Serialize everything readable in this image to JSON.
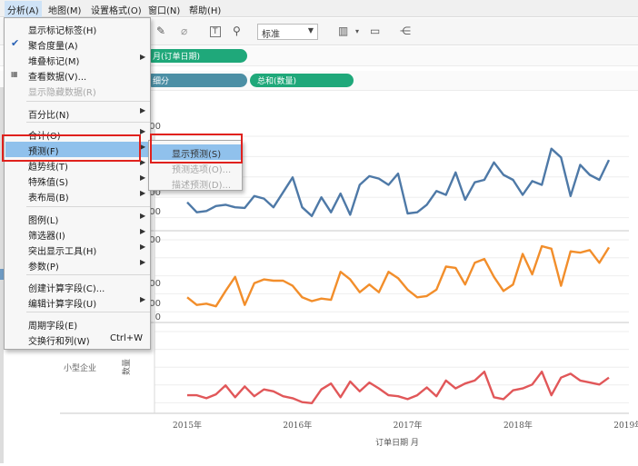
{
  "menubar": {
    "items": [
      "分析(A)",
      "地图(M)",
      "设置格式(O)",
      "窗口(N)",
      "帮助(H)"
    ]
  },
  "toolbar": {
    "mark_type": "标准"
  },
  "shelves": {
    "columns_pill": "月(订单日期)",
    "rows_pill_1": "细分",
    "rows_pill_2": "总和(数量)"
  },
  "analysis_menu": {
    "items": [
      {
        "label": "显示标记标签(H)"
      },
      {
        "label": "聚合度量(A)",
        "checked": true
      },
      {
        "label": "堆叠标记(M)",
        "submenu": true
      },
      {
        "label": "查看数据(V)..."
      },
      {
        "label": "显示隐藏数据(R)",
        "disabled": true
      },
      {
        "label": "百分比(N)",
        "submenu": true
      },
      {
        "label": "合计(O)",
        "submenu": true
      },
      {
        "label": "预测(F)",
        "submenu": true
      },
      {
        "label": "趋势线(T)",
        "submenu": true
      },
      {
        "label": "特殊值(S)",
        "submenu": true
      },
      {
        "label": "表布局(B)",
        "submenu": true
      },
      {
        "label": "图例(L)",
        "submenu": true
      },
      {
        "label": "筛选器(I)",
        "submenu": true
      },
      {
        "label": "突出显示工具(H)",
        "submenu": true
      },
      {
        "label": "参数(P)",
        "submenu": true
      },
      {
        "label": "创建计算字段(C)..."
      },
      {
        "label": "编辑计算字段(U)",
        "submenu": true
      },
      {
        "label": "周期字段(E)"
      },
      {
        "label": "交换行和列(W)",
        "shortcut": "Ctrl+W"
      }
    ]
  },
  "forecast_submenu": {
    "items": [
      {
        "label": "显示预测(S)"
      },
      {
        "label": "预测选项(O)...",
        "disabled": true
      },
      {
        "label": "描述预测(D)...",
        "disabled": true
      }
    ]
  },
  "chart_data": {
    "type": "line",
    "xlabel": "订单日期 月",
    "x_ticks": [
      "2015年",
      "2016年",
      "2017年",
      "2018年",
      "2019年"
    ],
    "row_header_label": "小型企业",
    "y_axis_label": "数量",
    "panes": [
      {
        "color": "#4e79a7",
        "y_ticks": [
          "00",
          "00"
        ],
        "values": [
          120,
          40,
          50,
          90,
          100,
          80,
          75,
          170,
          150,
          80,
          200,
          320,
          80,
          10,
          160,
          40,
          190,
          20,
          260,
          330,
          310,
          260,
          350,
          30,
          40,
          100,
          210,
          180,
          360,
          140,
          280,
          300,
          440,
          340,
          300,
          180,
          290,
          260,
          550,
          480,
          170,
          420,
          340,
          300,
          460
        ]
      },
      {
        "color": "#f28e2b",
        "y_ticks": [
          "400",
          "300",
          "200",
          "100"
        ],
        "values": [
          110,
          50,
          60,
          40,
          160,
          270,
          50,
          220,
          250,
          240,
          240,
          200,
          110,
          80,
          100,
          90,
          310,
          250,
          150,
          210,
          150,
          310,
          260,
          170,
          110,
          120,
          170,
          350,
          340,
          210,
          380,
          410,
          270,
          160,
          210,
          450,
          290,
          510,
          490,
          200,
          470,
          460,
          480,
          380,
          500
        ]
      },
      {
        "color": "#e15759",
        "y_ticks": [
          "600",
          "400",
          "200",
          "0"
        ],
        "values": [
          50,
          50,
          20,
          60,
          150,
          30,
          140,
          40,
          110,
          90,
          40,
          20,
          -20,
          -30,
          110,
          170,
          30,
          190,
          90,
          180,
          120,
          50,
          40,
          10,
          50,
          130,
          40,
          200,
          120,
          170,
          200,
          290,
          30,
          10,
          100,
          120,
          160,
          290,
          50,
          230,
          270,
          200,
          180,
          160,
          230
        ]
      }
    ]
  }
}
